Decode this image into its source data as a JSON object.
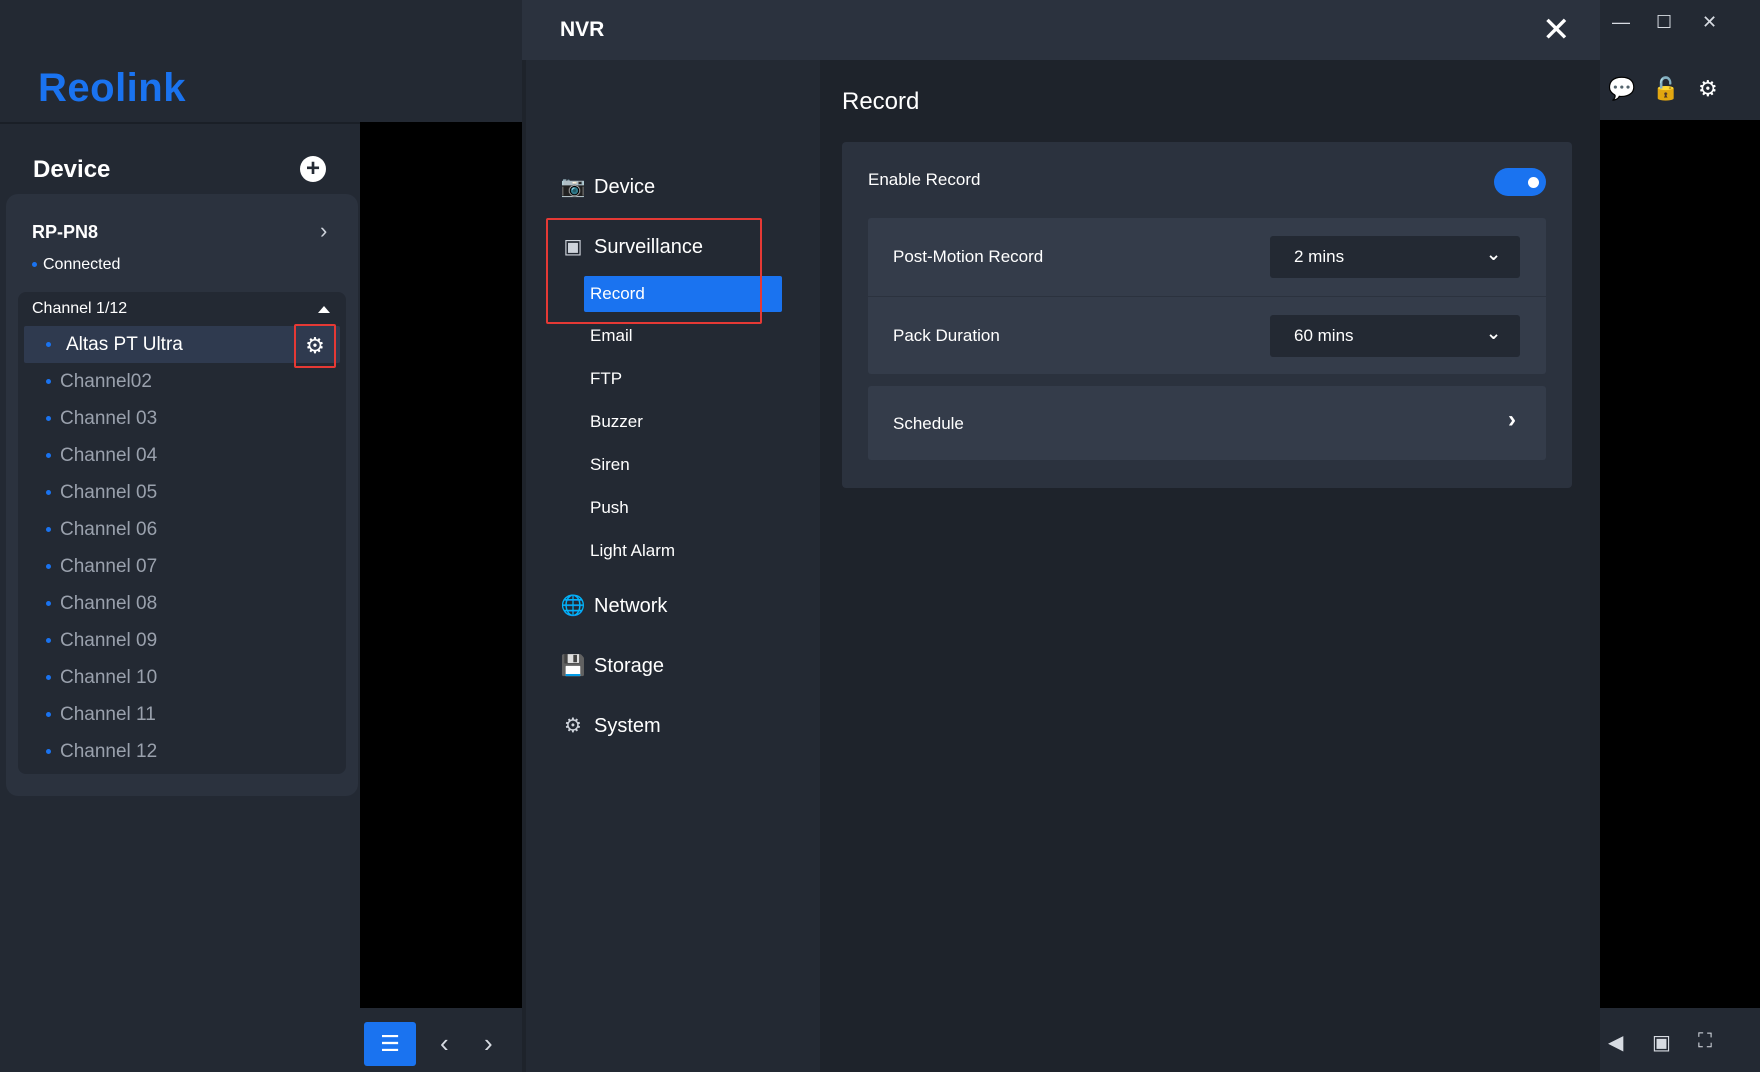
{
  "app": {
    "logo": "Reolink"
  },
  "sidebar": {
    "title": "Device",
    "add_icon": "plus-circle-icon",
    "device": {
      "name": "RP-PN8",
      "status": "Connected"
    },
    "channels": {
      "header": "Channel 1/12",
      "items": [
        "Altas PT Ultra",
        "Channel02",
        "Channel 03",
        "Channel 04",
        "Channel 05",
        "Channel 06",
        "Channel 07",
        "Channel 08",
        "Channel 09",
        "Channel 10",
        "Channel 11",
        "Channel 12"
      ],
      "selected_index": 0
    }
  },
  "modal": {
    "title": "NVR",
    "nav": {
      "device": "Device",
      "surveillance": "Surveillance",
      "surveillance_items": [
        "Record",
        "Email",
        "FTP",
        "Buzzer",
        "Siren",
        "Push",
        "Light Alarm"
      ],
      "network": "Network",
      "storage": "Storage",
      "system": "System"
    },
    "content": {
      "title": "Record",
      "enable_record": {
        "label": "Enable Record",
        "on": true
      },
      "post_motion": {
        "label": "Post-Motion Record",
        "value": "2 mins"
      },
      "pack_duration": {
        "label": "Pack Duration",
        "value": "60 mins"
      },
      "schedule": {
        "label": "Schedule"
      }
    }
  },
  "colors": {
    "accent": "#1a73f0",
    "highlight": "#e53935",
    "panel": "#2b323e",
    "background": "#1e232b"
  }
}
